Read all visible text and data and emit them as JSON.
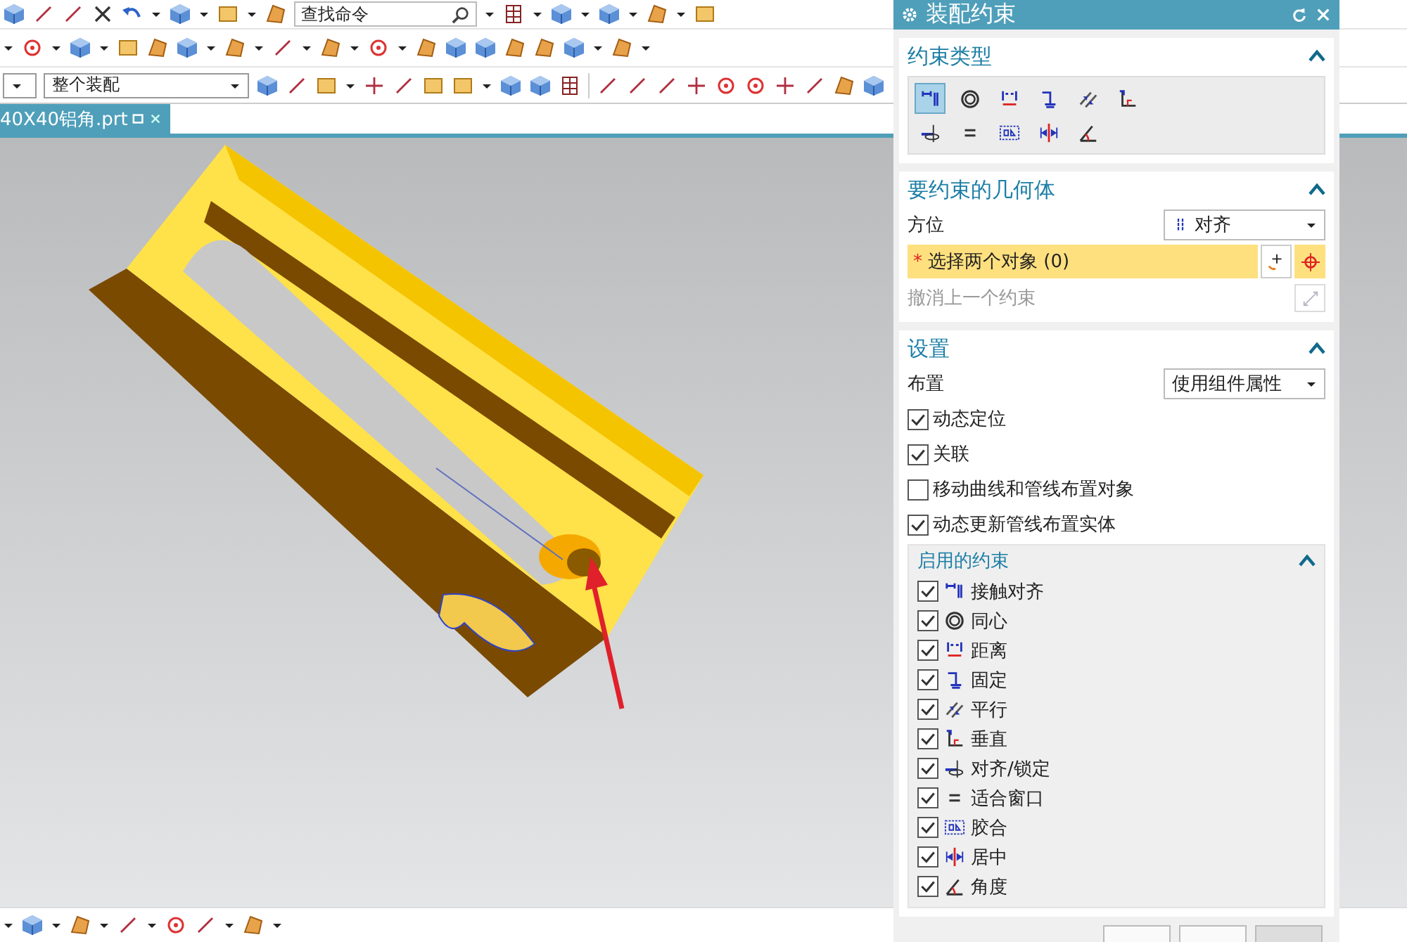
{
  "toolbar": {
    "search_field": {
      "value": "查找命令"
    },
    "assembly_filter": {
      "value": "整个装配"
    }
  },
  "document_tab": {
    "label": "40X40铝角.prt",
    "selected": true
  },
  "dialog": {
    "title": "装配约束",
    "constraint_type": {
      "title": "约束类型",
      "expanded": true,
      "types": [
        {
          "kind": "touch_align",
          "selected": true
        },
        {
          "kind": "concentric",
          "selected": false
        },
        {
          "kind": "distance",
          "selected": false
        },
        {
          "kind": "fix",
          "selected": false
        },
        {
          "kind": "parallel",
          "selected": false
        },
        {
          "kind": "perpendicular",
          "selected": false
        },
        {
          "kind": "align_lock",
          "selected": false
        },
        {
          "kind": "fit",
          "selected": false
        },
        {
          "kind": "bond",
          "selected": false
        },
        {
          "kind": "center",
          "selected": false
        },
        {
          "kind": "angle",
          "selected": false
        }
      ]
    },
    "geometry": {
      "title": "要约束的几何体",
      "expanded": true,
      "orientation_label": "方位",
      "orientation_value": "对齐",
      "required_mark": "*",
      "select_prompt": "选择两个对象 (0)",
      "undo_label": "撤消上一个约束",
      "undo_disabled": true
    },
    "settings": {
      "title": "设置",
      "expanded": true,
      "layout_label": "布置",
      "layout_value": "使用组件属性",
      "options": [
        {
          "label": "动态定位",
          "checked": true
        },
        {
          "label": "关联",
          "checked": true
        },
        {
          "label": "移动曲线和管线布置对象",
          "checked": false
        },
        {
          "label": "动态更新管线布置实体",
          "checked": true
        }
      ],
      "enabled_constraints": {
        "title": "启用的约束",
        "expanded": true,
        "items": [
          {
            "kind": "touch_align",
            "label": "接触对齐",
            "checked": true
          },
          {
            "kind": "concentric",
            "label": "同心",
            "checked": true
          },
          {
            "kind": "distance",
            "label": "距离",
            "checked": true
          },
          {
            "kind": "fix",
            "label": "固定",
            "checked": true
          },
          {
            "kind": "parallel",
            "label": "平行",
            "checked": true
          },
          {
            "kind": "perpendicular",
            "label": "垂直",
            "checked": true
          },
          {
            "kind": "align_lock",
            "label": "对齐/锁定",
            "checked": true
          },
          {
            "kind": "fit",
            "label": "适合窗口",
            "checked": true
          },
          {
            "kind": "bond",
            "label": "胶合",
            "checked": true
          },
          {
            "kind": "center",
            "label": "居中",
            "checked": true
          },
          {
            "kind": "angle",
            "label": "角度",
            "checked": true
          }
        ]
      }
    }
  }
}
